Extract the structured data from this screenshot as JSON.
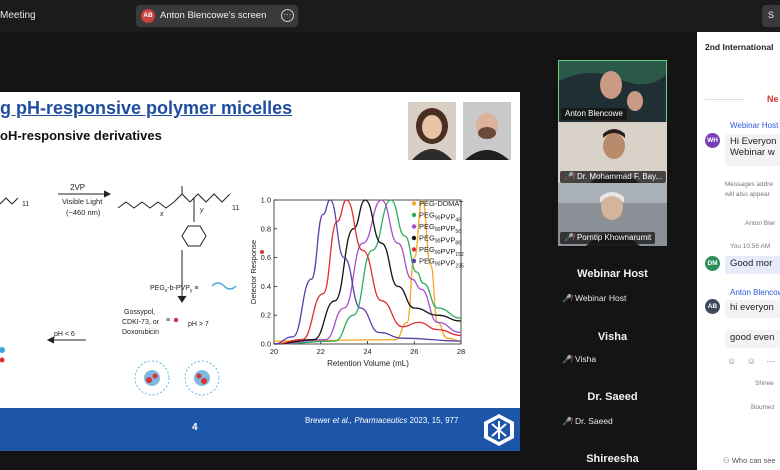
{
  "topbar": {
    "meeting_title": "Meeting",
    "share_avatar": "AB",
    "share_text": "Anton Blencowe's screen",
    "more_icon": "more-icon",
    "right_button": "S"
  },
  "slide": {
    "title": "g pH-responsive polymer micelles",
    "subtitle": "oH-responsive derivatives",
    "scheme": {
      "sub_11a": "11",
      "reagent_1": "2VP",
      "reagent_2": "Visible Light",
      "reagent_3": "(~460 nm)",
      "sub_x": "x",
      "sub_y": "y",
      "sub_11b": "11",
      "peg_label": "PEG",
      "peg_sub": "x",
      "peg_mid": "-b-PVP",
      "peg_sub2": "y",
      "peg_eq": "≡",
      "drug_1": "Gossypol,",
      "drug_2": "CDKI-73, or",
      "drug_3": "Doxorubicin",
      "ph_high": "pH > 7",
      "ph_low": "pH < 6",
      "drug_eq": "≡"
    },
    "footer_page": "4",
    "footer_cite_a": "Brewer ",
    "footer_cite_b": "et al., Pharmaceutics",
    "footer_cite_c": " 2023, 15, 977"
  },
  "chart_data": {
    "type": "line",
    "xlabel": "Retention Volume (mL)",
    "ylabel": "Detector Response",
    "xlim": [
      20,
      28
    ],
    "ylim": [
      0,
      1.0
    ],
    "x_ticks": [
      20,
      22,
      24,
      26,
      28
    ],
    "y_ticks": [
      0.0,
      0.2,
      0.4,
      0.6,
      0.8,
      1.0
    ],
    "legend_position": "top-right",
    "series": [
      {
        "name": "PEG-DDMAT",
        "sub": "",
        "color": "#f5a623",
        "points": [
          [
            20,
            0.02
          ],
          [
            25.2,
            0.03
          ],
          [
            25.7,
            0.15
          ],
          [
            26.0,
            0.6
          ],
          [
            26.35,
            1.0
          ],
          [
            26.7,
            0.55
          ],
          [
            27.0,
            0.15
          ],
          [
            27.4,
            0.04
          ],
          [
            28,
            0.02
          ]
        ]
      },
      {
        "name": "PEG",
        "sub": "90",
        "name2": "PVP",
        "sub2": "46",
        "color": "#2eaa5e",
        "points": [
          [
            20,
            0.0
          ],
          [
            22.6,
            0.02
          ],
          [
            23.4,
            0.2
          ],
          [
            24.2,
            0.65
          ],
          [
            25.0,
            1.0
          ],
          [
            25.6,
            0.75
          ],
          [
            26.1,
            0.5
          ],
          [
            26.4,
            0.42
          ],
          [
            27.0,
            0.25
          ],
          [
            28,
            0.18
          ]
        ]
      },
      {
        "name": "PEG",
        "sub": "90",
        "name2": "PVP",
        "sub2": "56",
        "color": "#a64dcf",
        "points": [
          [
            20,
            0.0
          ],
          [
            22.2,
            0.03
          ],
          [
            23.0,
            0.25
          ],
          [
            23.8,
            0.7
          ],
          [
            24.6,
            1.0
          ],
          [
            25.3,
            0.7
          ],
          [
            25.9,
            0.45
          ],
          [
            26.3,
            0.38
          ],
          [
            27.0,
            0.15
          ],
          [
            28,
            0.08
          ]
        ]
      },
      {
        "name": "PEG",
        "sub": "90",
        "name2": "PVP",
        "sub2": "86",
        "color": "#111111",
        "points": [
          [
            20,
            0.0
          ],
          [
            21.7,
            0.03
          ],
          [
            22.6,
            0.3
          ],
          [
            23.4,
            0.8
          ],
          [
            23.9,
            1.0
          ],
          [
            24.6,
            0.7
          ],
          [
            25.3,
            0.4
          ],
          [
            26.0,
            0.25
          ],
          [
            27.0,
            0.2
          ],
          [
            28,
            0.16
          ]
        ]
      },
      {
        "name": "PEG",
        "sub": "90",
        "name2": "PVP",
        "sub2": "152",
        "color": "#e02f2f",
        "points": [
          [
            20,
            0.0
          ],
          [
            21.2,
            0.03
          ],
          [
            22.1,
            0.35
          ],
          [
            22.7,
            0.85
          ],
          [
            23.1,
            1.0
          ],
          [
            23.8,
            0.65
          ],
          [
            24.6,
            0.3
          ],
          [
            25.5,
            0.12
          ],
          [
            26.2,
            0.15
          ],
          [
            27.0,
            0.1
          ],
          [
            28,
            0.06
          ]
        ]
      },
      {
        "name": "PEG",
        "sub": "90",
        "name2": "PVP",
        "sub2": "235",
        "color": "#5b3fa8",
        "points": [
          [
            20,
            0.0
          ],
          [
            20.8,
            0.05
          ],
          [
            21.6,
            0.45
          ],
          [
            22.1,
            0.9
          ],
          [
            22.4,
            1.0
          ],
          [
            23.0,
            0.6
          ],
          [
            23.7,
            0.25
          ],
          [
            24.5,
            0.08
          ],
          [
            25.5,
            0.04
          ],
          [
            28,
            0.02
          ]
        ]
      }
    ]
  },
  "tiles": [
    {
      "label": "Anton Blencowe",
      "muted": false
    },
    {
      "label": "Dr. Mohammad F. Bay...",
      "muted": true
    },
    {
      "label": "Porntip Khownarumit",
      "muted": true
    }
  ],
  "participants": [
    {
      "name": "Webinar Host",
      "sub": "Webinar Host"
    },
    {
      "name": "Visha",
      "sub": "Visha"
    },
    {
      "name": "Dr. Saeed",
      "sub": "Dr. Saeed"
    },
    {
      "name": "Shireesha"
    }
  ],
  "mic_off_icon": "mic-off-icon",
  "chat": {
    "header": "2nd International",
    "new_marker": "Ne",
    "msg1_avatar": "WH",
    "msg1_avatar_color": "#7b3fb5",
    "msg1_name": "Webinar Host",
    "msg1_line1": "Hi Everyon",
    "msg1_line2": "Webinar w",
    "sys_line1": "Messages addre",
    "sys_line2": "will also appear",
    "sys_author": "Anton Bler",
    "msg2_meta": "You 10:56 AM",
    "msg2_avatar": "DM",
    "msg2_avatar_color": "#2f8f5b",
    "msg2_text": "Good mor",
    "msg3_avatar": "AB",
    "msg3_avatar_color": "#3b4a5a",
    "msg3_name": "Anton Blencowe",
    "msg3_text1": "hi everyon",
    "msg3_text2": "good even",
    "reactions": "☺ ☺ ⋯",
    "reader_1": "Shiree",
    "reader_2": "Boumez",
    "footer": "Who can see"
  }
}
